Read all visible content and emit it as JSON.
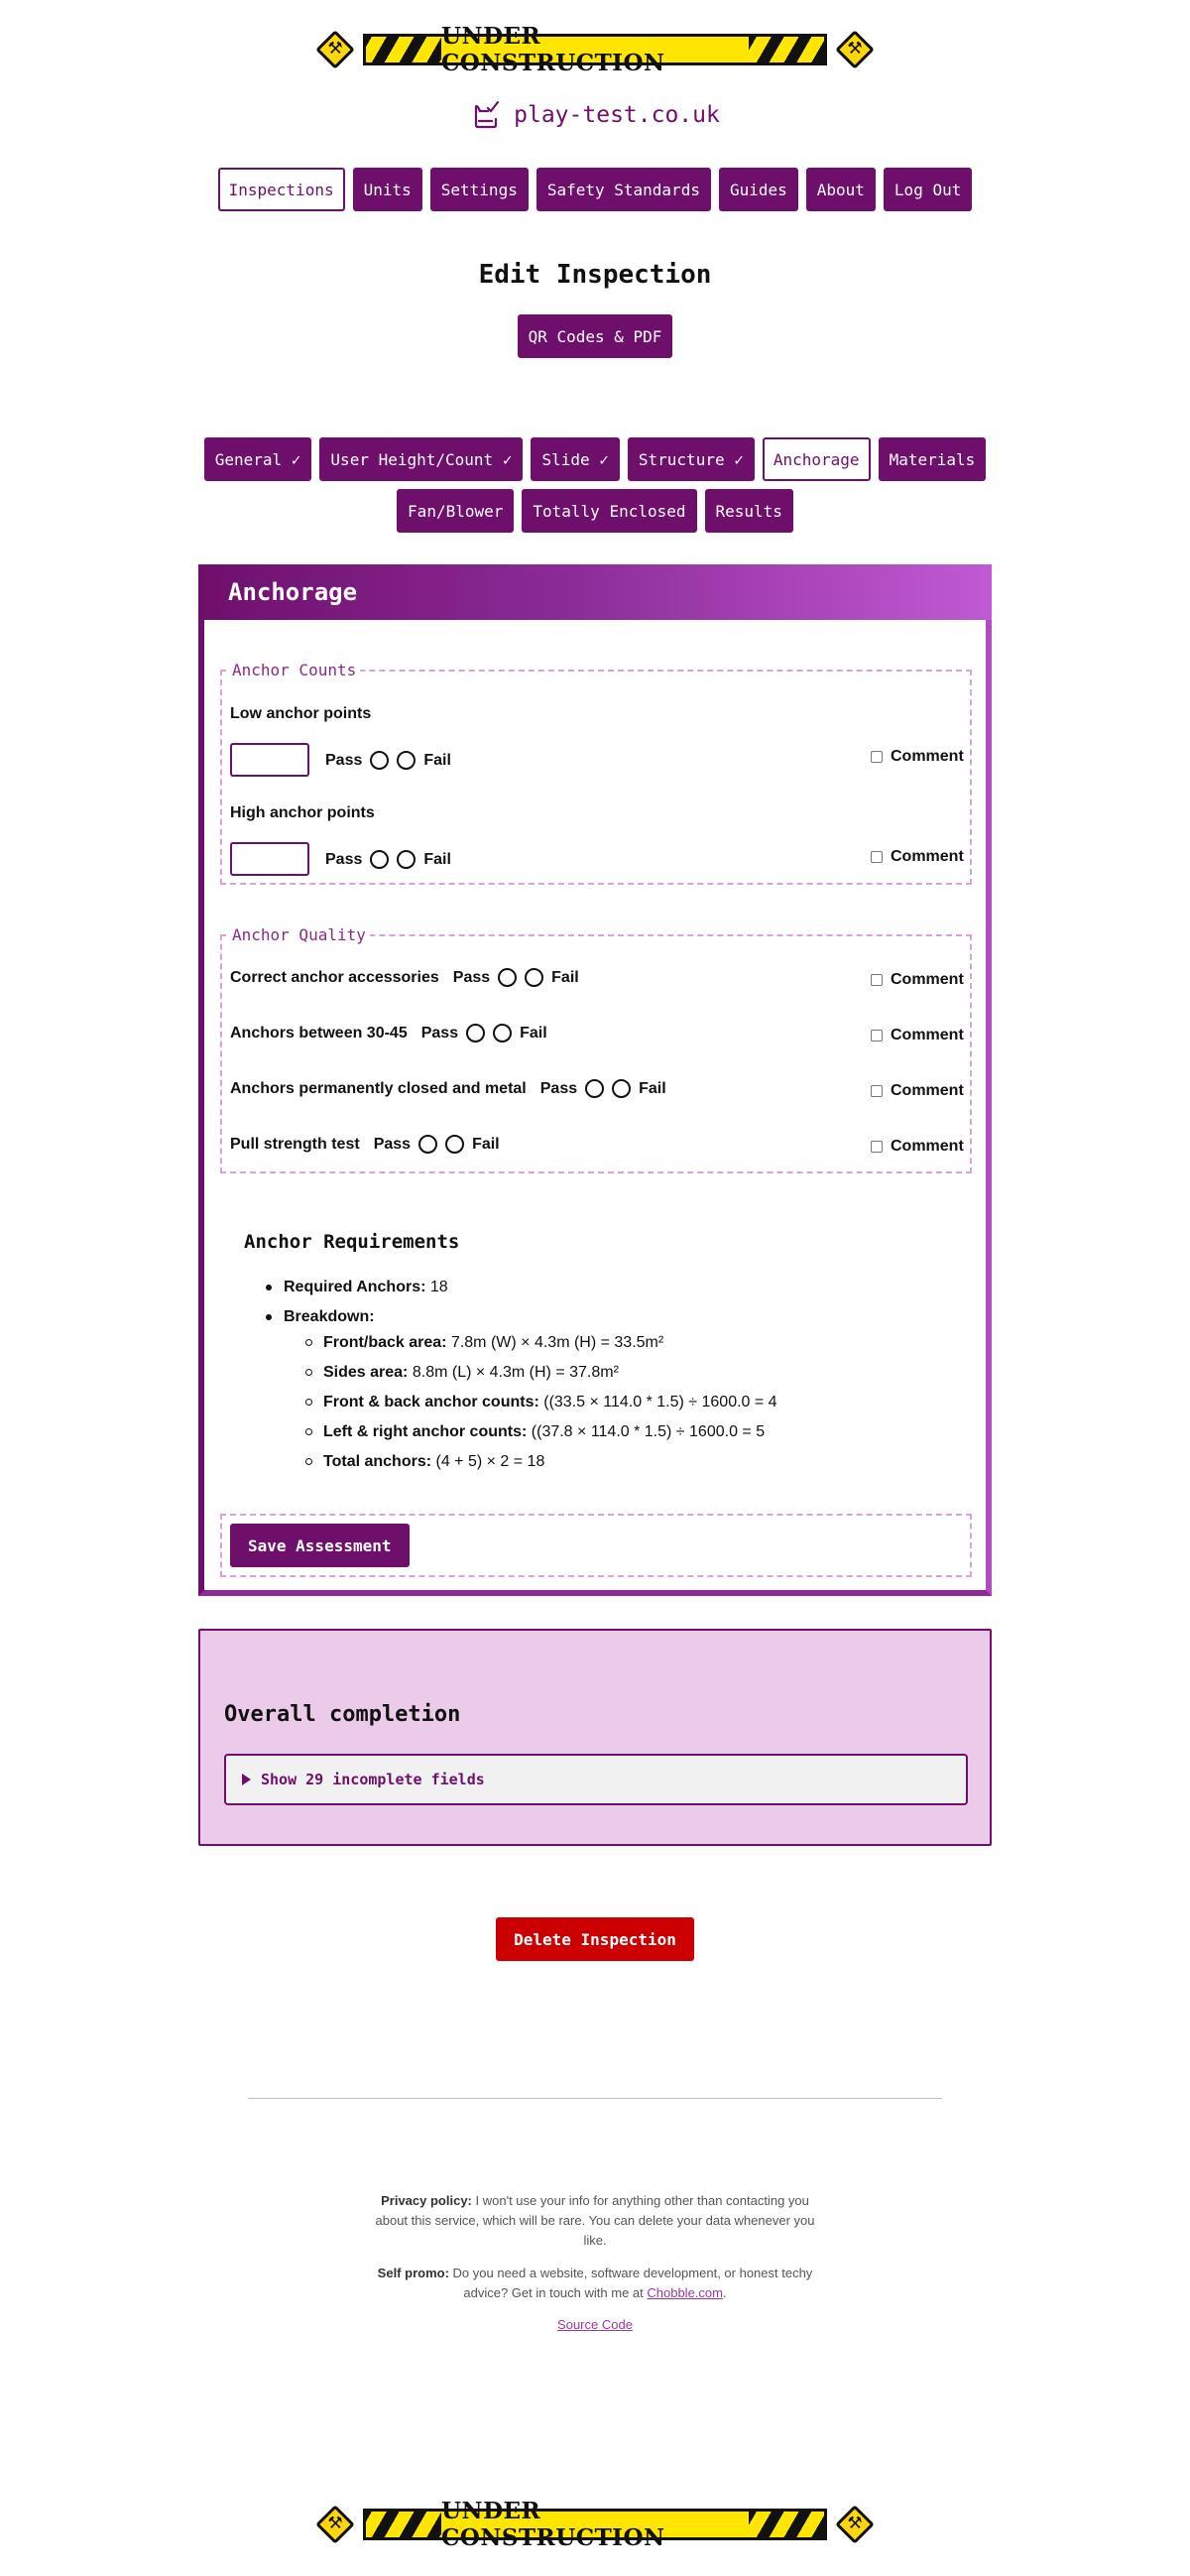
{
  "banner": {
    "text": "UNDER CONSTRUCTION"
  },
  "site": {
    "name": "play-test.co.uk",
    "logo_icon": "clipboard-check-icon"
  },
  "nav": {
    "items": [
      {
        "label": "Inspections",
        "active": true
      },
      {
        "label": "Units"
      },
      {
        "label": "Settings"
      },
      {
        "label": "Safety Standards"
      },
      {
        "label": "Guides"
      },
      {
        "label": "About"
      },
      {
        "label": "Log Out"
      }
    ]
  },
  "page": {
    "title": "Edit Inspection",
    "qr_button": "QR Codes & PDF"
  },
  "tabs": {
    "row1": [
      "General ✓",
      "User Height/Count ✓",
      "Slide ✓",
      "Structure ✓",
      "Anchorage",
      "Materials"
    ],
    "row2": [
      "Fan/Blower",
      "Totally Enclosed",
      "Results"
    ],
    "active": "Anchorage"
  },
  "form": {
    "title": "Anchorage",
    "counts": {
      "legend": "Anchor Counts",
      "low_label": "Low anchor points",
      "high_label": "High anchor points"
    },
    "quality": {
      "legend": "Anchor Quality",
      "items": [
        "Correct anchor accessories",
        "Anchors between 30-45",
        "Anchors permanently closed and metal",
        "Pull strength test"
      ]
    },
    "pass_label": "Pass",
    "fail_label": "Fail",
    "comment_label": "Comment",
    "requirements": {
      "title": "Anchor Requirements",
      "required_label": "Required Anchors:",
      "required_value": "18",
      "breakdown_label": "Breakdown:",
      "breakdown": [
        {
          "label": "Front/back area:",
          "value": "7.8m (W) × 4.3m (H) = 33.5m²"
        },
        {
          "label": "Sides area:",
          "value": "8.8m (L) × 4.3m (H) = 37.8m²"
        },
        {
          "label": "Front & back anchor counts:",
          "value": "((33.5 × 114.0 * 1.5) ÷ 1600.0 = 4"
        },
        {
          "label": "Left & right anchor counts:",
          "value": "((37.8 × 114.0 * 1.5) ÷ 1600.0 = 5"
        },
        {
          "label": "Total anchors:",
          "value": "(4 + 5) × 2 = 18"
        }
      ]
    },
    "save_label": "Save Assessment"
  },
  "completion": {
    "title": "Overall completion",
    "summary": "Show 29 incomplete fields"
  },
  "delete_label": "Delete Inspection",
  "footer": {
    "privacy_label": "Privacy policy:",
    "privacy_text": "I won't use your info for anything other than contacting you about this service, which will be rare. You can delete your data whenever you like.",
    "promo_label": "Self promo:",
    "promo_text": "Do you need a website, software development, or honest techy advice? Get in touch with me at",
    "promo_link": "Chobble.com",
    "source_link": "Source Code"
  },
  "colors": {
    "brand": "#6f0f6c",
    "delete": "#cc0000",
    "completion_bg": "#eccbea",
    "warning": "#ffe600"
  }
}
